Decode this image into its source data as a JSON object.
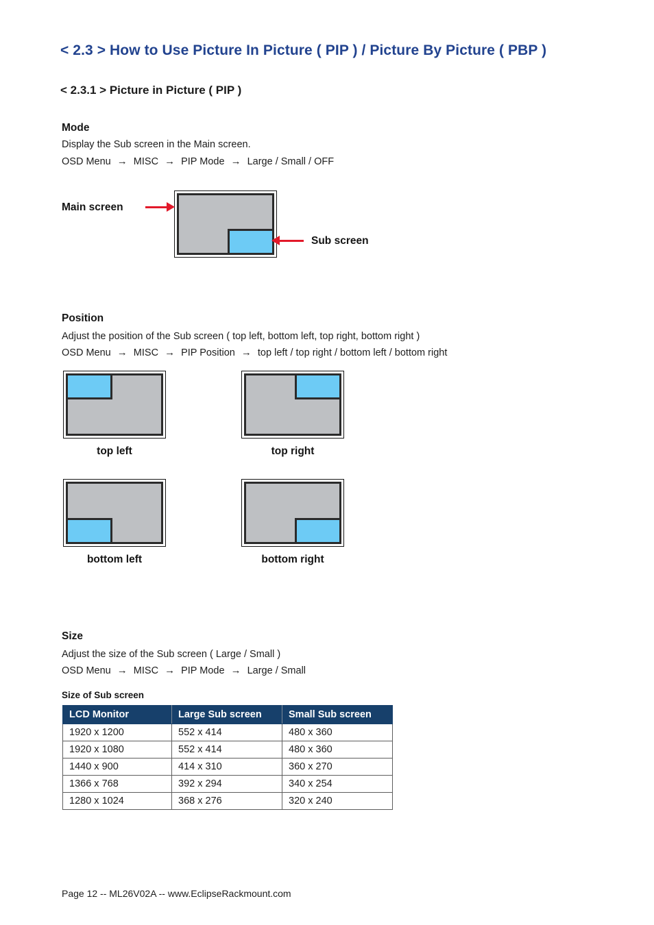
{
  "document": {
    "title": "< 2.3 > How to Use Picture In Picture ( PIP )  /  Picture By Picture ( PBP )",
    "subtitle": "< 2.3.1 > Picture in Picture ( PIP )",
    "footer": "Page 12 -- ML26V02A -- www.EclipseRackmount.com"
  },
  "colors": {
    "title_blue": "#22438f",
    "table_header_navy": "#17406b",
    "screen_gray": "#bec0c3",
    "sub_screen_blue": "#6dcbf5",
    "arrow_red": "#e2192a",
    "border_dark": "#2b2b2b"
  },
  "mode": {
    "heading": "Mode",
    "description": "Display the Sub screen in the Main screen.",
    "path": {
      "step1": "OSD Menu",
      "step2": "MISC",
      "step3": "PIP Mode",
      "arrow": "→",
      "options": "Large  /  Small  /  OFF"
    },
    "diagram": {
      "main_label": "Main screen",
      "sub_label": "Sub screen"
    }
  },
  "position": {
    "heading": "Position",
    "description": "Adjust the position of the Sub screen  ( top left, bottom left, top right, bottom right )",
    "path": {
      "step1": "OSD Menu",
      "step2": "MISC",
      "step3": "PIP Position",
      "arrow": "→",
      "options": "top left  /  top right  /  bottom left  /  bottom right"
    },
    "diagrams": [
      {
        "caption": "top left",
        "placement": "top-left"
      },
      {
        "caption": "top right",
        "placement": "top-right"
      },
      {
        "caption": "bottom left",
        "placement": "bottom-left"
      },
      {
        "caption": "bottom right",
        "placement": "bottom-right"
      }
    ]
  },
  "size": {
    "heading": "Size",
    "description": "Adjust the size of the Sub screen  ( Large  /  Small )",
    "path": {
      "step1": "OSD Menu",
      "step2": "MISC",
      "step3": "PIP Mode",
      "arrow": "→",
      "options": "Large  /  Small"
    },
    "table_caption": "Size of Sub screen",
    "table": {
      "headers": [
        "LCD Monitor",
        "Large Sub screen",
        "Small Sub screen"
      ],
      "rows": [
        [
          "1920 x 1200",
          "552 x 414",
          "480 x 360"
        ],
        [
          "1920 x 1080",
          "552 x 414",
          "480 x 360"
        ],
        [
          "1440 x 900",
          "414 x 310",
          "360 x 270"
        ],
        [
          "1366 x 768",
          "392 x 294",
          "340 x 254"
        ],
        [
          "1280 x 1024",
          "368 x 276",
          "320 x 240"
        ]
      ]
    }
  }
}
